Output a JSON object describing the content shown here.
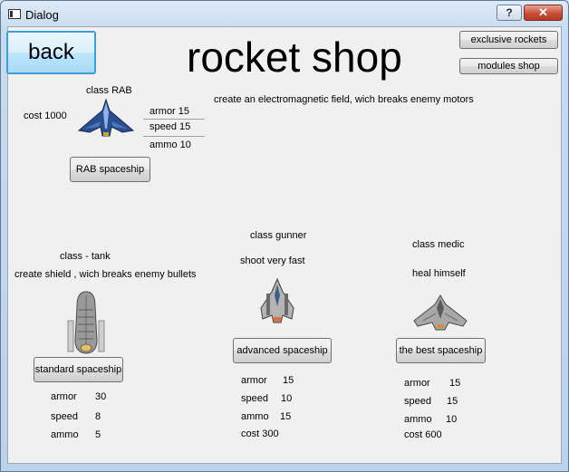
{
  "window": {
    "title": "Dialog",
    "help_label": "?",
    "close_label": "✕"
  },
  "header": {
    "back_label": "back",
    "title": "rocket shop",
    "exclusive_label": "exclusive rockets",
    "modules_label": "modules shop"
  },
  "rab": {
    "class_label": "class RAB",
    "cost": "cost 1000",
    "armor": "armor 15",
    "speed": "speed 15",
    "ammo": "ammo 10",
    "description": "create an electromagnetic field,  wich breaks enemy motors",
    "button_label": "RAB spaceship"
  },
  "tank": {
    "class_label": "class - tank",
    "description": "create shield , wich breaks enemy bullets",
    "button_label": "standard spaceship",
    "stats": [
      {
        "label": "armor",
        "value": "30"
      },
      {
        "label": "speed",
        "value": "8"
      },
      {
        "label": "ammo",
        "value": "5"
      }
    ]
  },
  "gunner": {
    "class_label": "class gunner",
    "description": "shoot very fast",
    "button_label": "advanced spaceship",
    "stats": [
      {
        "label": "armor",
        "value": "15"
      },
      {
        "label": "speed",
        "value": "10"
      },
      {
        "label": "ammo",
        "value": "15"
      }
    ],
    "cost": "cost 300"
  },
  "medic": {
    "class_label": "class medic",
    "description": "heal himself",
    "button_label": "the best spaceship",
    "stats": [
      {
        "label": "armor",
        "value": "15"
      },
      {
        "label": "speed",
        "value": "15"
      },
      {
        "label": "ammo",
        "value": "10"
      }
    ],
    "cost": "cost 600"
  }
}
